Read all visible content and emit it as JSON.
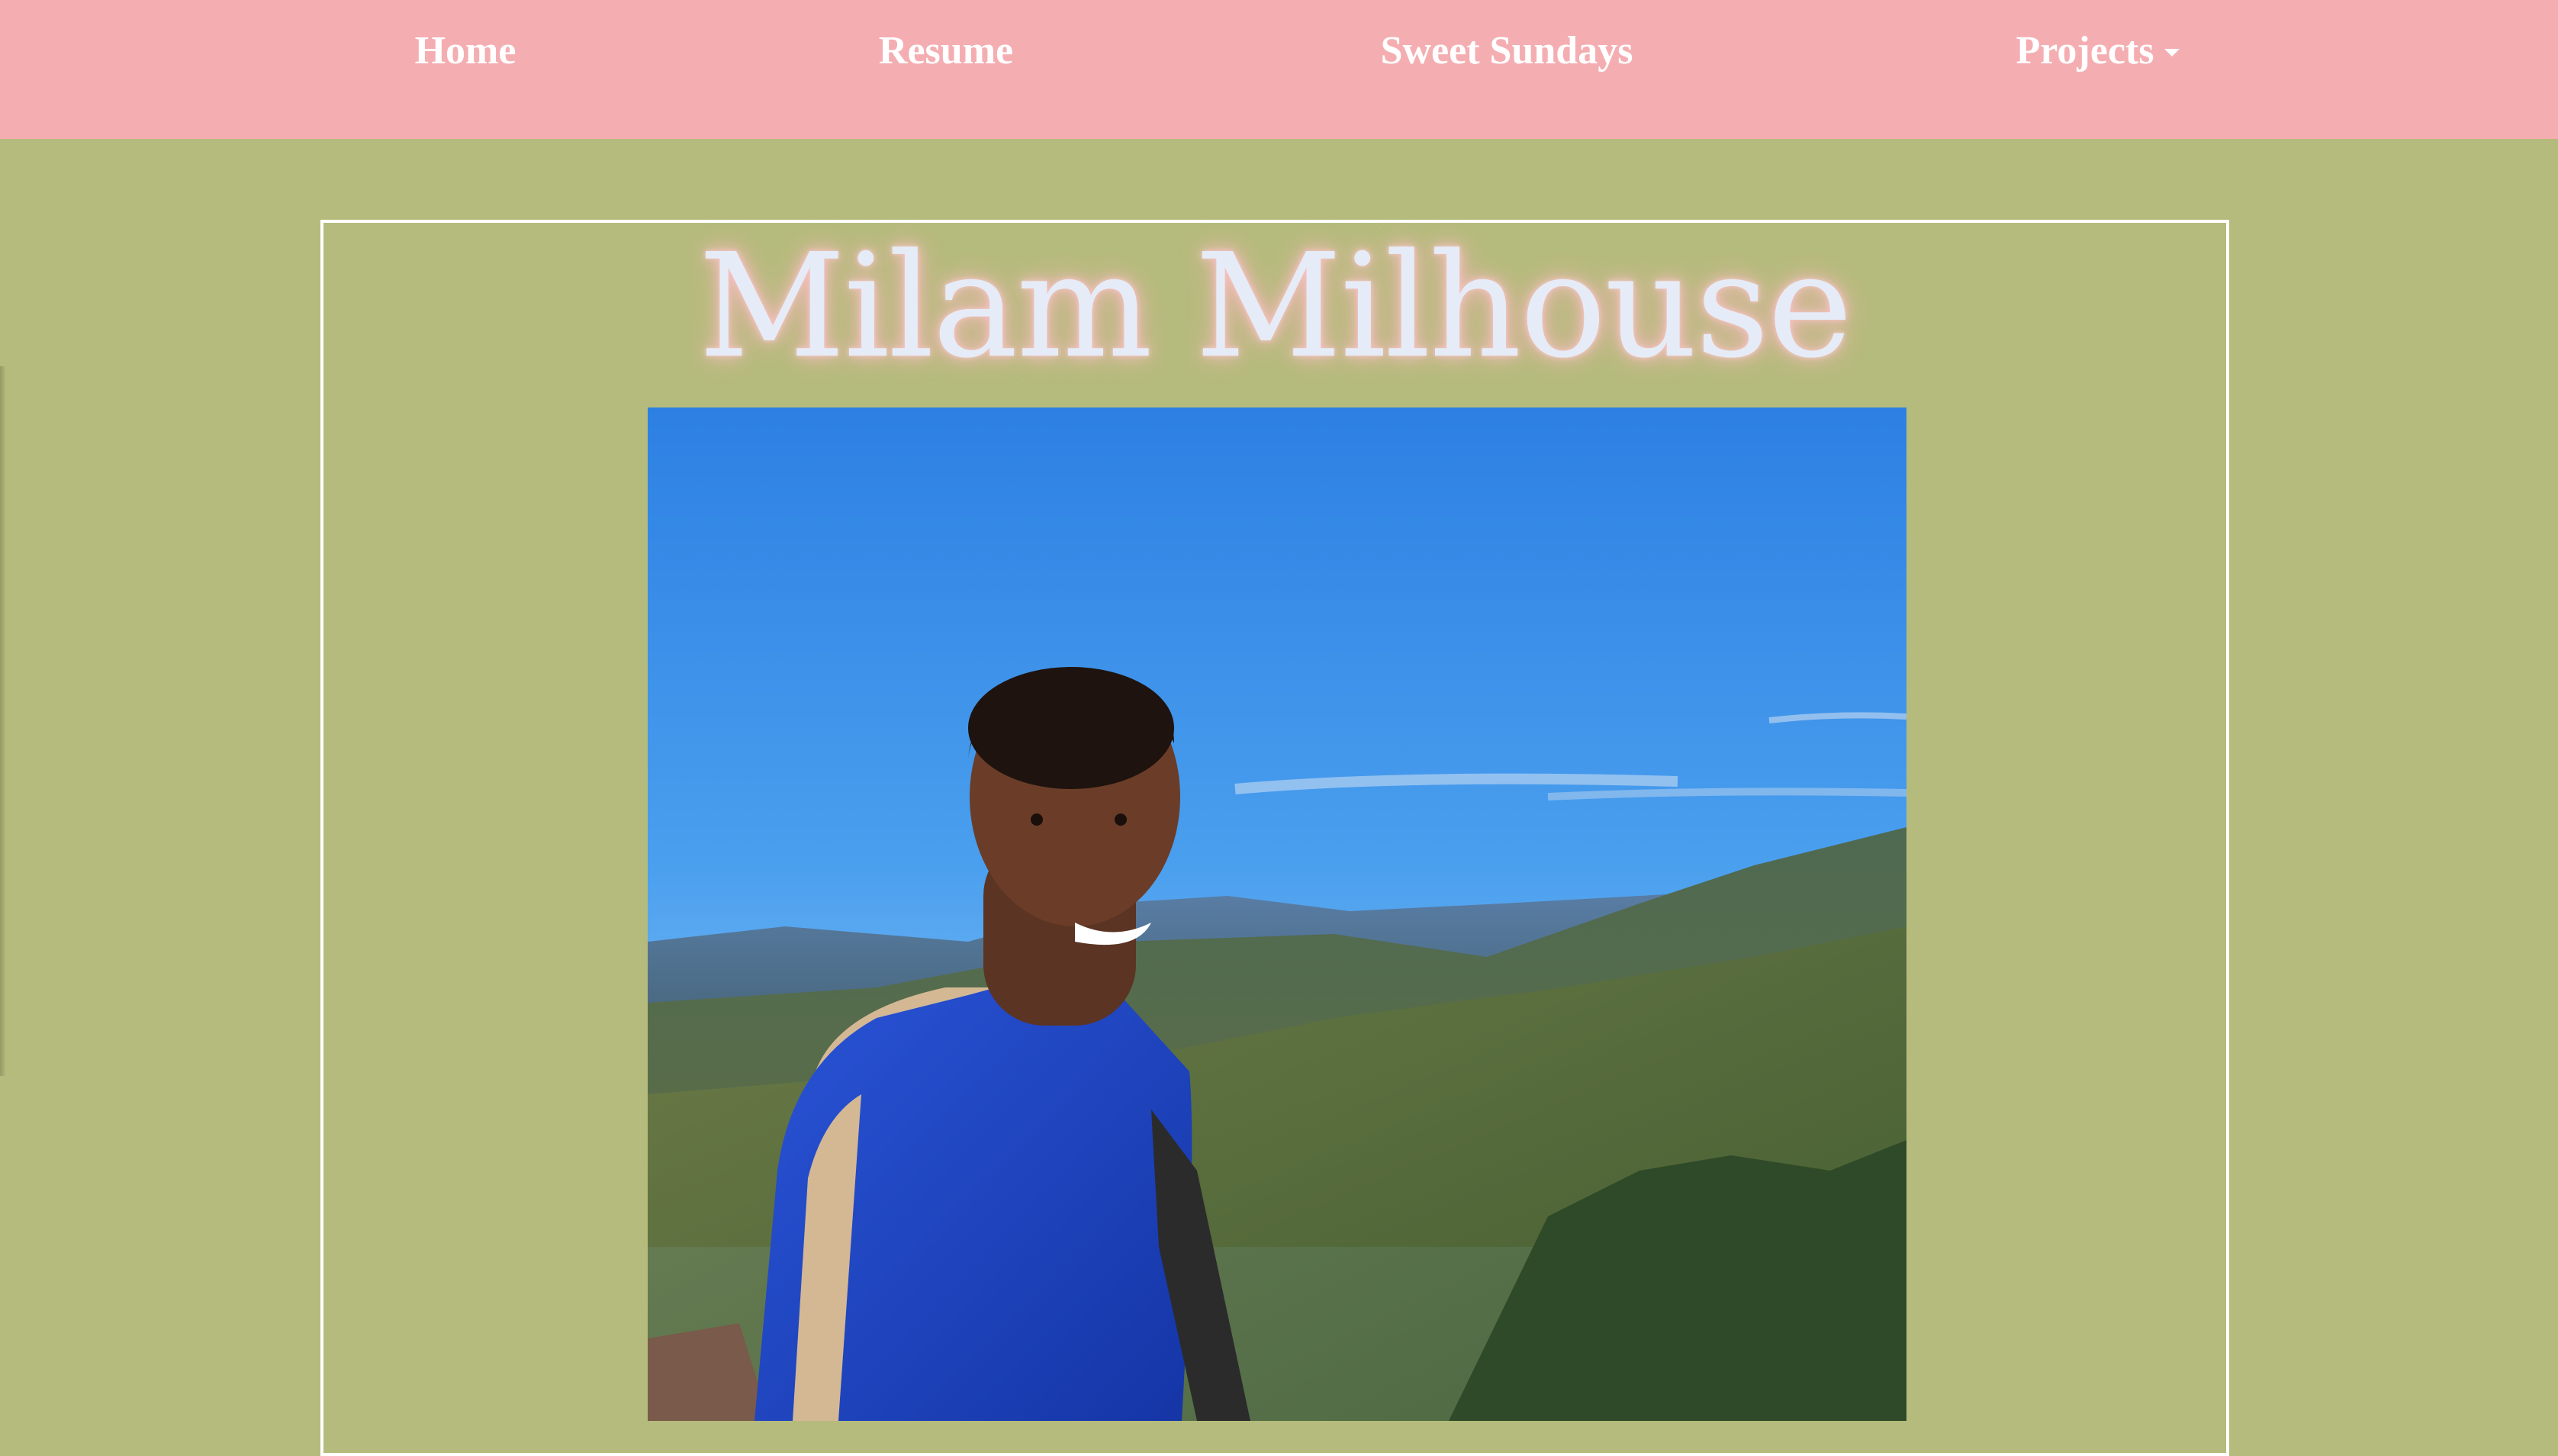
{
  "nav": {
    "items": [
      {
        "label": "Home"
      },
      {
        "label": "Resume"
      },
      {
        "label": "Sweet Sundays"
      },
      {
        "label": "Projects",
        "has_dropdown": true
      }
    ]
  },
  "hero": {
    "title": "Milam Milhouse",
    "photo_icon": "portrait-photo"
  },
  "colors": {
    "nav_background": "#f4aeb2",
    "page_background": "#b5bb7c",
    "frame_border": "#ffffff",
    "title_text": "#e6ecf7",
    "title_glow": "#f2b0b3"
  }
}
